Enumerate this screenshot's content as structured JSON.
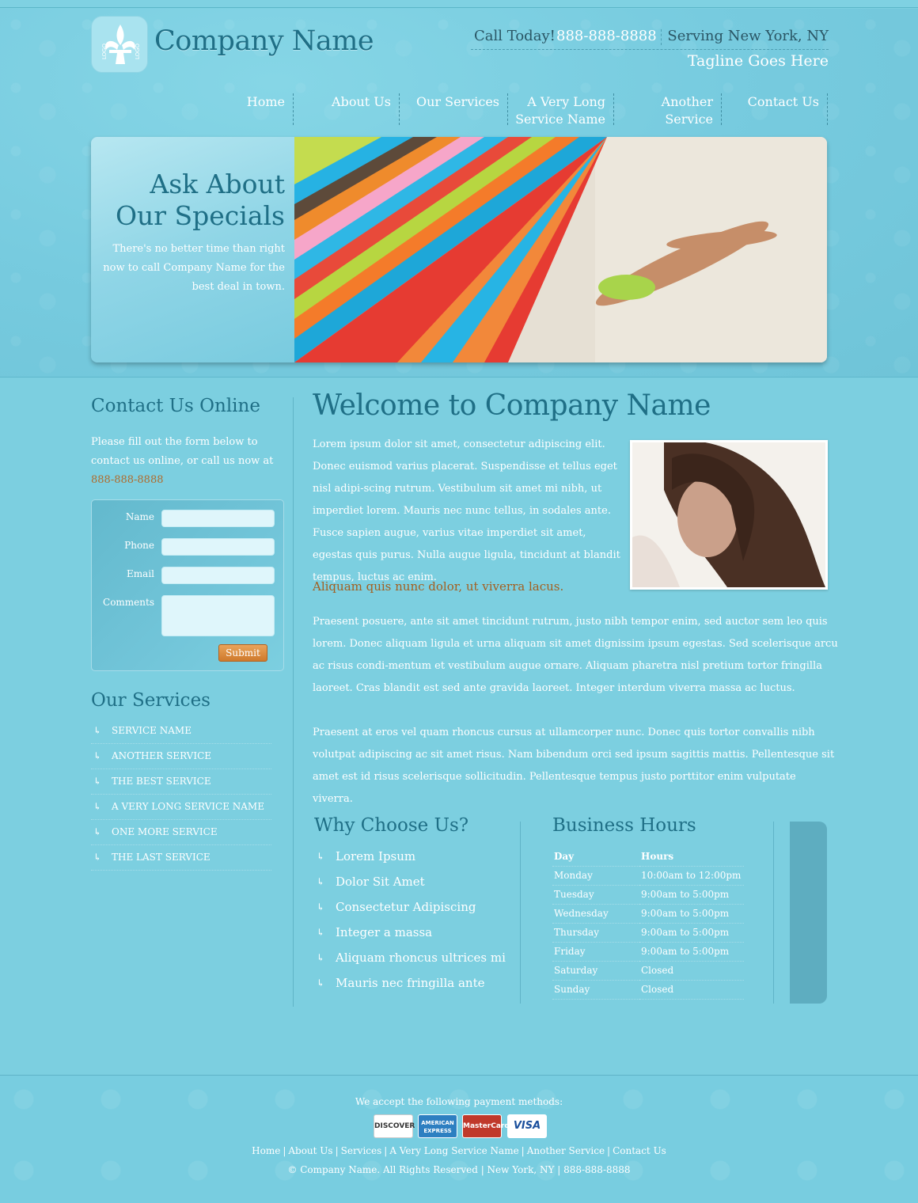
{
  "header": {
    "company_name": "Company Name",
    "logo_text": "LOGO",
    "call_label": "Call Today!",
    "call_number": "888-888-8888",
    "serving": "Serving New York, NY",
    "tagline": "Tagline Goes Here"
  },
  "nav": [
    {
      "label": "Home"
    },
    {
      "label": "About Us"
    },
    {
      "label": "Our Services"
    },
    {
      "label": "A Very Long\nService Name"
    },
    {
      "label": "Another\nService"
    },
    {
      "label": "Contact Us"
    }
  ],
  "banner": {
    "title_line1": "Ask About",
    "title_line2": "Our Specials",
    "text": "There's no better time than right now to call Company Name for the best deal in town."
  },
  "sidebar": {
    "contact_heading": "Contact Us Online",
    "contact_intro": "Please fill out the form below to contact us online, or call us now at",
    "contact_phone": "888-888-8888",
    "form": {
      "name_label": "Name",
      "phone_label": "Phone",
      "email_label": "Email",
      "comments_label": "Comments",
      "submit_label": "Submit"
    },
    "services_heading": "Our Services",
    "services": [
      "SERVICE NAME",
      "ANOTHER SERVICE",
      "THE BEST SERVICE",
      "A VERY LONG SERVICE NAME",
      "ONE MORE SERVICE",
      "THE LAST SERVICE"
    ]
  },
  "main": {
    "welcome": "Welcome to Company Name",
    "p1": "Lorem ipsum dolor sit amet, consectetur adipiscing elit. Donec euismod varius placerat. Suspendisse et tellus eget nisl adipi-scing rutrum. Vestibulum sit amet mi nibh, ut imperdiet lorem. Mauris nec nunc tellus, in sodales ante. Fusce sapien augue, varius vitae imperdiet sit amet, egestas quis purus. Nulla augue ligula, tincidunt at blandit tempus, luctus ac enim.",
    "accent": "Aliquam quis nunc dolor, ut viverra lacus.",
    "p2": "Praesent posuere, ante sit amet tincidunt rutrum, justo nibh tempor enim, sed auctor sem leo quis lorem. Donec aliquam ligula et urna aliquam sit amet dignissim ipsum egestas. Sed scelerisque arcu ac risus condi-mentum et vestibulum augue ornare. Aliquam pharetra nisl pretium tortor fringilla laoreet. Cras blandit est sed ante gravida laoreet. Integer interdum viverra massa ac luctus.",
    "p3": "Praesent at eros vel quam rhoncus cursus at ullamcorper nunc. Donec quis tortor convallis nibh volutpat adipiscing ac sit amet risus. Nam bibendum orci sed ipsum sagittis mattis. Pellentesque sit amet est id risus scelerisque sollicitudin. Pellentesque tempus justo porttitor enim vulputate viverra."
  },
  "why": {
    "heading": "Why Choose Us?",
    "items": [
      "Lorem Ipsum",
      "Dolor Sit Amet",
      "Consectetur Adipiscing",
      "Integer a massa",
      "Aliquam rhoncus ultrices mi",
      "Mauris nec fringilla ante"
    ]
  },
  "hours": {
    "heading": "Business Hours",
    "col_day": "Day",
    "col_hours": "Hours",
    "rows": [
      {
        "day": "Monday",
        "hours": "10:00am to 12:00pm"
      },
      {
        "day": "Tuesday",
        "hours": "9:00am to 5:00pm"
      },
      {
        "day": "Wednesday",
        "hours": "9:00am to 5:00pm"
      },
      {
        "day": "Thursday",
        "hours": "9:00am to 5:00pm"
      },
      {
        "day": "Friday",
        "hours": "9:00am to 5:00pm"
      },
      {
        "day": "Saturday",
        "hours": "Closed"
      },
      {
        "day": "Sunday",
        "hours": "Closed"
      }
    ]
  },
  "footer": {
    "payment_label": "We accept the following payment methods:",
    "cards": [
      "DISCOVER",
      "AMERICAN EXPRESS",
      "MasterCard",
      "VISA"
    ],
    "links": [
      "Home",
      "About Us",
      "Services",
      "A Very Long Service Name",
      "Another Service",
      "Contact Us"
    ],
    "copyright": "© Company Name. All Rights Reserved | New York, NY | 888-888-8888"
  },
  "colors": {
    "background": "#7ccfe0",
    "heading": "#1f6f86",
    "accent": "#a35f1f",
    "submit": "#d9893a"
  }
}
